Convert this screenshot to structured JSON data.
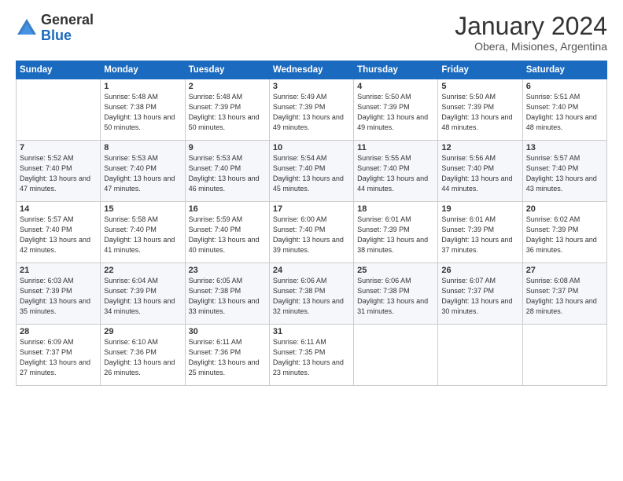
{
  "logo": {
    "general": "General",
    "blue": "Blue"
  },
  "header": {
    "month": "January 2024",
    "location": "Obera, Misiones, Argentina"
  },
  "weekdays": [
    "Sunday",
    "Monday",
    "Tuesday",
    "Wednesday",
    "Thursday",
    "Friday",
    "Saturday"
  ],
  "weeks": [
    [
      {
        "day": "",
        "sunrise": "",
        "sunset": "",
        "daylight": ""
      },
      {
        "day": "1",
        "sunrise": "Sunrise: 5:48 AM",
        "sunset": "Sunset: 7:38 PM",
        "daylight": "Daylight: 13 hours and 50 minutes."
      },
      {
        "day": "2",
        "sunrise": "Sunrise: 5:48 AM",
        "sunset": "Sunset: 7:39 PM",
        "daylight": "Daylight: 13 hours and 50 minutes."
      },
      {
        "day": "3",
        "sunrise": "Sunrise: 5:49 AM",
        "sunset": "Sunset: 7:39 PM",
        "daylight": "Daylight: 13 hours and 49 minutes."
      },
      {
        "day": "4",
        "sunrise": "Sunrise: 5:50 AM",
        "sunset": "Sunset: 7:39 PM",
        "daylight": "Daylight: 13 hours and 49 minutes."
      },
      {
        "day": "5",
        "sunrise": "Sunrise: 5:50 AM",
        "sunset": "Sunset: 7:39 PM",
        "daylight": "Daylight: 13 hours and 48 minutes."
      },
      {
        "day": "6",
        "sunrise": "Sunrise: 5:51 AM",
        "sunset": "Sunset: 7:40 PM",
        "daylight": "Daylight: 13 hours and 48 minutes."
      }
    ],
    [
      {
        "day": "7",
        "sunrise": "Sunrise: 5:52 AM",
        "sunset": "Sunset: 7:40 PM",
        "daylight": "Daylight: 13 hours and 47 minutes."
      },
      {
        "day": "8",
        "sunrise": "Sunrise: 5:53 AM",
        "sunset": "Sunset: 7:40 PM",
        "daylight": "Daylight: 13 hours and 47 minutes."
      },
      {
        "day": "9",
        "sunrise": "Sunrise: 5:53 AM",
        "sunset": "Sunset: 7:40 PM",
        "daylight": "Daylight: 13 hours and 46 minutes."
      },
      {
        "day": "10",
        "sunrise": "Sunrise: 5:54 AM",
        "sunset": "Sunset: 7:40 PM",
        "daylight": "Daylight: 13 hours and 45 minutes."
      },
      {
        "day": "11",
        "sunrise": "Sunrise: 5:55 AM",
        "sunset": "Sunset: 7:40 PM",
        "daylight": "Daylight: 13 hours and 44 minutes."
      },
      {
        "day": "12",
        "sunrise": "Sunrise: 5:56 AM",
        "sunset": "Sunset: 7:40 PM",
        "daylight": "Daylight: 13 hours and 44 minutes."
      },
      {
        "day": "13",
        "sunrise": "Sunrise: 5:57 AM",
        "sunset": "Sunset: 7:40 PM",
        "daylight": "Daylight: 13 hours and 43 minutes."
      }
    ],
    [
      {
        "day": "14",
        "sunrise": "Sunrise: 5:57 AM",
        "sunset": "Sunset: 7:40 PM",
        "daylight": "Daylight: 13 hours and 42 minutes."
      },
      {
        "day": "15",
        "sunrise": "Sunrise: 5:58 AM",
        "sunset": "Sunset: 7:40 PM",
        "daylight": "Daylight: 13 hours and 41 minutes."
      },
      {
        "day": "16",
        "sunrise": "Sunrise: 5:59 AM",
        "sunset": "Sunset: 7:40 PM",
        "daylight": "Daylight: 13 hours and 40 minutes."
      },
      {
        "day": "17",
        "sunrise": "Sunrise: 6:00 AM",
        "sunset": "Sunset: 7:40 PM",
        "daylight": "Daylight: 13 hours and 39 minutes."
      },
      {
        "day": "18",
        "sunrise": "Sunrise: 6:01 AM",
        "sunset": "Sunset: 7:39 PM",
        "daylight": "Daylight: 13 hours and 38 minutes."
      },
      {
        "day": "19",
        "sunrise": "Sunrise: 6:01 AM",
        "sunset": "Sunset: 7:39 PM",
        "daylight": "Daylight: 13 hours and 37 minutes."
      },
      {
        "day": "20",
        "sunrise": "Sunrise: 6:02 AM",
        "sunset": "Sunset: 7:39 PM",
        "daylight": "Daylight: 13 hours and 36 minutes."
      }
    ],
    [
      {
        "day": "21",
        "sunrise": "Sunrise: 6:03 AM",
        "sunset": "Sunset: 7:39 PM",
        "daylight": "Daylight: 13 hours and 35 minutes."
      },
      {
        "day": "22",
        "sunrise": "Sunrise: 6:04 AM",
        "sunset": "Sunset: 7:39 PM",
        "daylight": "Daylight: 13 hours and 34 minutes."
      },
      {
        "day": "23",
        "sunrise": "Sunrise: 6:05 AM",
        "sunset": "Sunset: 7:38 PM",
        "daylight": "Daylight: 13 hours and 33 minutes."
      },
      {
        "day": "24",
        "sunrise": "Sunrise: 6:06 AM",
        "sunset": "Sunset: 7:38 PM",
        "daylight": "Daylight: 13 hours and 32 minutes."
      },
      {
        "day": "25",
        "sunrise": "Sunrise: 6:06 AM",
        "sunset": "Sunset: 7:38 PM",
        "daylight": "Daylight: 13 hours and 31 minutes."
      },
      {
        "day": "26",
        "sunrise": "Sunrise: 6:07 AM",
        "sunset": "Sunset: 7:37 PM",
        "daylight": "Daylight: 13 hours and 30 minutes."
      },
      {
        "day": "27",
        "sunrise": "Sunrise: 6:08 AM",
        "sunset": "Sunset: 7:37 PM",
        "daylight": "Daylight: 13 hours and 28 minutes."
      }
    ],
    [
      {
        "day": "28",
        "sunrise": "Sunrise: 6:09 AM",
        "sunset": "Sunset: 7:37 PM",
        "daylight": "Daylight: 13 hours and 27 minutes."
      },
      {
        "day": "29",
        "sunrise": "Sunrise: 6:10 AM",
        "sunset": "Sunset: 7:36 PM",
        "daylight": "Daylight: 13 hours and 26 minutes."
      },
      {
        "day": "30",
        "sunrise": "Sunrise: 6:11 AM",
        "sunset": "Sunset: 7:36 PM",
        "daylight": "Daylight: 13 hours and 25 minutes."
      },
      {
        "day": "31",
        "sunrise": "Sunrise: 6:11 AM",
        "sunset": "Sunset: 7:35 PM",
        "daylight": "Daylight: 13 hours and 23 minutes."
      },
      {
        "day": "",
        "sunrise": "",
        "sunset": "",
        "daylight": ""
      },
      {
        "day": "",
        "sunrise": "",
        "sunset": "",
        "daylight": ""
      },
      {
        "day": "",
        "sunrise": "",
        "sunset": "",
        "daylight": ""
      }
    ]
  ]
}
